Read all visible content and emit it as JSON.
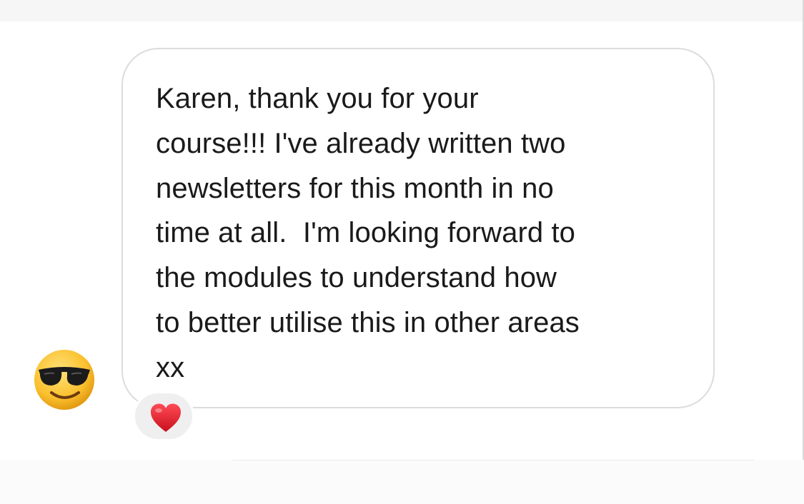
{
  "message": {
    "text": "Karen, thank you for your\ncourse!!! I've already written two\nnewsletters for this month in no\ntime at all.  I'm looking forward to\nthe modules to understand how\nto better utilise this in other areas\nxx"
  },
  "sender": {
    "avatar_icon": "smiling-face-with-sunglasses-icon"
  },
  "reaction": {
    "icon": "red-heart-icon",
    "color": "#e0202f"
  },
  "colors": {
    "bubble_border": "#dcdcdc",
    "reaction_background": "#efefef"
  }
}
